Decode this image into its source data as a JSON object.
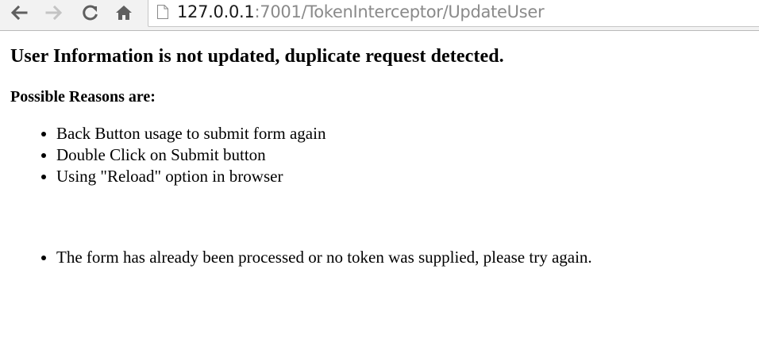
{
  "browser": {
    "url_host": "127.0.0.1",
    "url_rest": ":7001/TokenInterceptor/UpdateUser"
  },
  "page": {
    "title": "User Information is not updated, duplicate request detected.",
    "reasons_heading": "Possible Reasons are:",
    "reasons": [
      "Back Button usage to submit form again",
      "Double Click on Submit button",
      "Using \"Reload\" option in browser"
    ],
    "message": "The form has already been processed or no token was supplied, please try again."
  }
}
